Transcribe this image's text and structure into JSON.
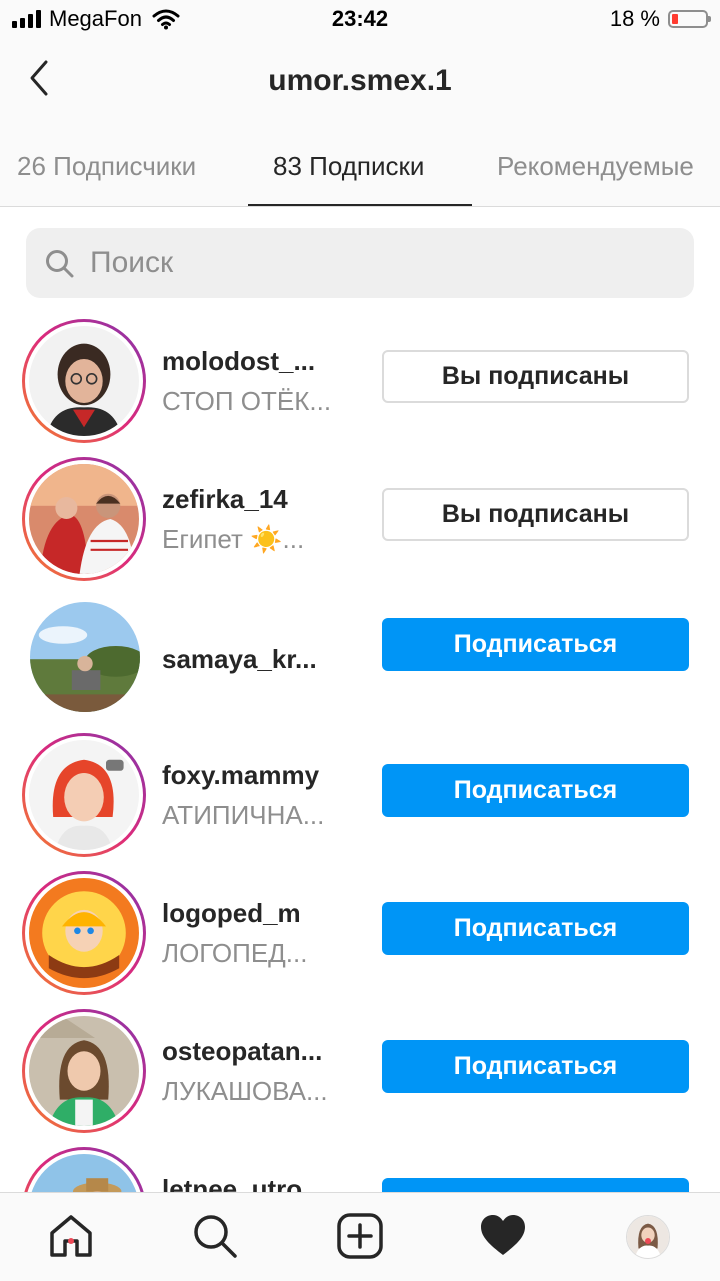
{
  "status_bar": {
    "carrier": "MegaFon",
    "time": "23:42",
    "battery_text": "18 %",
    "battery_level": 0.18
  },
  "header": {
    "title": "umor.smex.1"
  },
  "tabs": [
    {
      "label": "26 Подписчики",
      "active": false
    },
    {
      "label": "83 Подписки",
      "active": true
    },
    {
      "label": "Рекомендуемые",
      "active": false
    }
  ],
  "search": {
    "placeholder": "Поиск",
    "value": ""
  },
  "users": [
    {
      "username": "molodost_...",
      "subtitle": "СТОП ОТЁК...",
      "button": "Вы подписаны",
      "state": "following",
      "story_ring": true
    },
    {
      "username": "zefirka_14",
      "subtitle": "Египет ☀️...",
      "button": "Вы подписаны",
      "state": "following",
      "story_ring": true
    },
    {
      "username": "samaya_kr...",
      "subtitle": "",
      "button": "Подписаться",
      "state": "follow",
      "story_ring": false
    },
    {
      "username": "foxy.mammy",
      "subtitle": "АТИПИЧНА...",
      "button": "Подписаться",
      "state": "follow",
      "story_ring": true
    },
    {
      "username": "logoped_m",
      "subtitle": "ЛОГОПЕД...",
      "button": "Подписаться",
      "state": "follow",
      "story_ring": true
    },
    {
      "username": "osteopatan...",
      "subtitle": "ЛУКАШОВА...",
      "button": "Подписаться",
      "state": "follow",
      "story_ring": true
    },
    {
      "username": "letnee_utro",
      "subtitle": "",
      "button": "Подписаться",
      "state": "follow",
      "story_ring": true
    }
  ],
  "tabbar": {
    "items": [
      "home-icon",
      "search-icon",
      "new-post-icon",
      "activity-heart-icon",
      "profile-avatar"
    ]
  },
  "colors": {
    "accent": "#0095f6",
    "text": "#262626",
    "secondary": "#8e8e8e",
    "divider": "#dbdbdb",
    "notification": "#ed4956"
  }
}
